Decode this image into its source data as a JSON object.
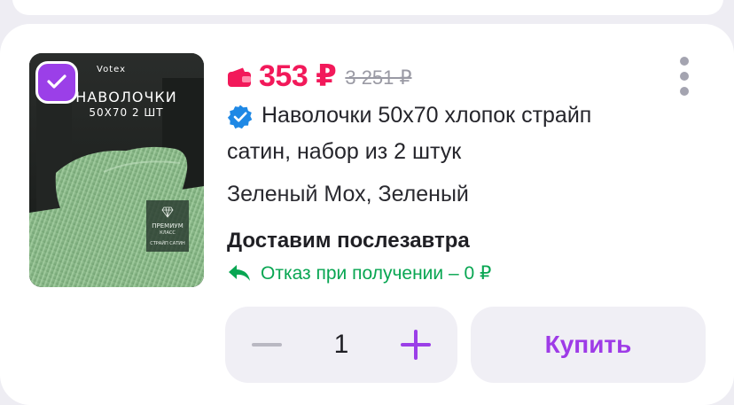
{
  "product": {
    "image": {
      "brand": "Votex",
      "title": "НАВОЛОЧКИ",
      "size": "50Х70 2 ШТ",
      "badge_title": "ПРЕМИУМ",
      "badge_sub": "КЛАСС",
      "badge_foot": "СТРАЙП САТИН"
    },
    "selected": true,
    "price": "353 ₽",
    "old_price": "3 251 ₽",
    "title_line1": "Наволочки 50х70 хлопок страйп",
    "title_line2": "сатин, набор из 2 штук",
    "variant": "Зеленый Мох, Зеленый",
    "delivery": "Доставим послезавтра",
    "refusal": "Отказ при получении – 0 ₽"
  },
  "quantity": {
    "value": "1"
  },
  "buy_button": {
    "label": "Купить"
  },
  "colors": {
    "accent": "#9b3fe8",
    "price": "#f2195a",
    "success": "#08a652",
    "verified": "#1e88e5",
    "control_bg": "#f0eff5"
  },
  "icons": [
    "checkbox-checked-icon",
    "wallet-icon",
    "more-vertical-icon",
    "verified-icon",
    "return-icon",
    "minus-icon",
    "plus-icon",
    "diamond-icon"
  ]
}
